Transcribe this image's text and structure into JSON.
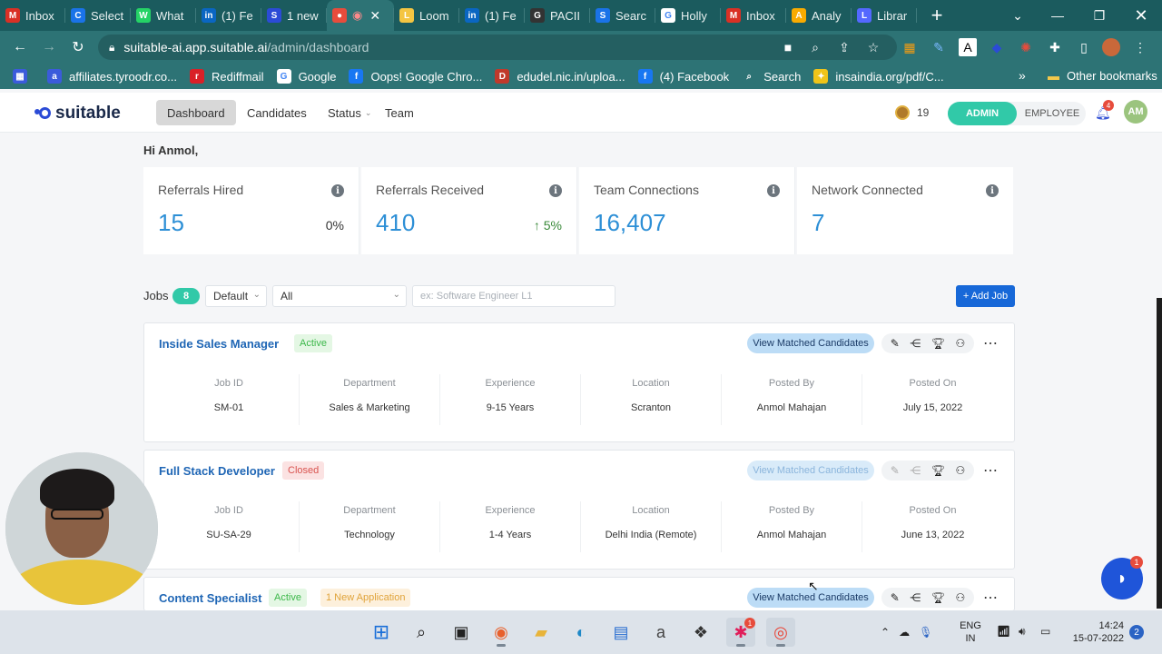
{
  "browser": {
    "tabs": [
      {
        "label": "Inbox",
        "icon": "gmail-icon",
        "color": "#d93025",
        "glyph": "M"
      },
      {
        "label": "Select",
        "icon": "select-icon",
        "color": "#1a73e8",
        "glyph": "C"
      },
      {
        "label": "What",
        "icon": "whatsapp-icon",
        "color": "#25d366",
        "glyph": "W"
      },
      {
        "label": "(1) Fe",
        "icon": "linkedin-icon",
        "color": "#0a66c2",
        "glyph": "in"
      },
      {
        "label": "1 new",
        "icon": "new-icon",
        "color": "#2b4bd6",
        "glyph": "S"
      },
      {
        "label": "",
        "icon": "recording-icon",
        "color": "#e74c3c",
        "glyph": "●",
        "active": true
      },
      {
        "label": "Loom",
        "icon": "loom-icon",
        "color": "#f4c542",
        "glyph": "L"
      },
      {
        "label": "(1) Fe",
        "icon": "linkedin-icon",
        "color": "#0a66c2",
        "glyph": "in"
      },
      {
        "label": "PACII",
        "icon": "github-icon",
        "color": "#333333",
        "glyph": "G"
      },
      {
        "label": "Searc",
        "icon": "search-tab-icon",
        "color": "#1a73e8",
        "glyph": "S"
      },
      {
        "label": "Holly",
        "icon": "google-icon",
        "color": "#ffffff",
        "glyph": "G"
      },
      {
        "label": "Inbox",
        "icon": "gmail-icon",
        "color": "#d93025",
        "glyph": "M"
      },
      {
        "label": "Analy",
        "icon": "analytics-icon",
        "color": "#f9ab00",
        "glyph": "A"
      },
      {
        "label": "Librar",
        "icon": "library-icon",
        "color": "#5468ff",
        "glyph": "L"
      }
    ],
    "url_host": "suitable-ai.app.suitable.ai",
    "url_path": "/admin/dashboard",
    "bookmarks": [
      {
        "label": "affiliates.tyroodr.co...",
        "icon": "tyroo-icon",
        "color": "#3b5bdb",
        "glyph": "a"
      },
      {
        "label": "Rediffmail",
        "icon": "rediff-icon",
        "color": "#d92027",
        "glyph": "r"
      },
      {
        "label": "Google",
        "icon": "google-icon",
        "color": "#ffffff",
        "glyph": "G"
      },
      {
        "label": "Oops! Google Chro...",
        "icon": "facebook-icon",
        "color": "#1877f2",
        "glyph": "f"
      },
      {
        "label": "edudel.nic.in/uploa...",
        "icon": "edudel-icon",
        "color": "#c0392b",
        "glyph": "D"
      },
      {
        "label": "(4) Facebook",
        "icon": "facebook-icon",
        "color": "#1877f2",
        "glyph": "f"
      },
      {
        "label": "Search",
        "icon": "search-bookmark-icon",
        "color": "#2d7375",
        "glyph": "⌕"
      },
      {
        "label": "insaindia.org/pdf/C...",
        "icon": "insa-icon",
        "color": "#f0c419",
        "glyph": "✦"
      }
    ],
    "other_bookmarks": "Other bookmarks",
    "more_bookmarks": "»"
  },
  "app": {
    "brand": "suitable",
    "nav": [
      "Dashboard",
      "Candidates",
      "Status",
      "Team"
    ],
    "coins": "19",
    "role_admin": "ADMIN",
    "role_employee": "EMPLOYEE",
    "notifications": "4",
    "avatar": "AM"
  },
  "greeting": "Hi Anmol,",
  "stats": [
    {
      "label": "Referrals Hired",
      "value": "15",
      "delta": "0%",
      "trend": "none"
    },
    {
      "label": "Referrals Received",
      "value": "410",
      "delta": "5%",
      "trend": "up"
    },
    {
      "label": "Team Connections",
      "value": "16,407",
      "delta": "",
      "trend": "none"
    },
    {
      "label": "Network Connected",
      "value": "7",
      "delta": "",
      "trend": "none"
    }
  ],
  "jobs": {
    "title": "Jobs",
    "count": "8",
    "sort": "Default",
    "filter": "All",
    "search_placeholder": "ex: Software Engineer L1",
    "add_label": "+ Add Job",
    "view_matched_label": "View Matched Candidates",
    "columns": [
      "Job ID",
      "Department",
      "Experience",
      "Location",
      "Posted By",
      "Posted On"
    ],
    "list": [
      {
        "title": "Inside Sales Manager",
        "status": "Active",
        "new_apps": "",
        "values": [
          "SM-01",
          "Sales & Marketing",
          "9-15 Years",
          "Scranton",
          "Anmol Mahajan",
          "July 15, 2022"
        ]
      },
      {
        "title": "Full Stack Developer",
        "status": "Closed",
        "new_apps": "",
        "values": [
          "SU-SA-29",
          "Technology",
          "1-4 Years",
          "Delhi India (Remote)",
          "Anmol Mahajan",
          "June 13, 2022"
        ]
      },
      {
        "title": "Content Specialist",
        "status": "Active",
        "new_apps": "1 New Application",
        "values": [
          "",
          "",
          "",
          "",
          "",
          ""
        ]
      }
    ]
  },
  "chat_badge": "1",
  "taskbar": {
    "lang_top": "ENG",
    "lang_bottom": "IN",
    "time": "14:24",
    "date": "15-07-2022",
    "notifications": "2",
    "slack_badge": "1"
  }
}
